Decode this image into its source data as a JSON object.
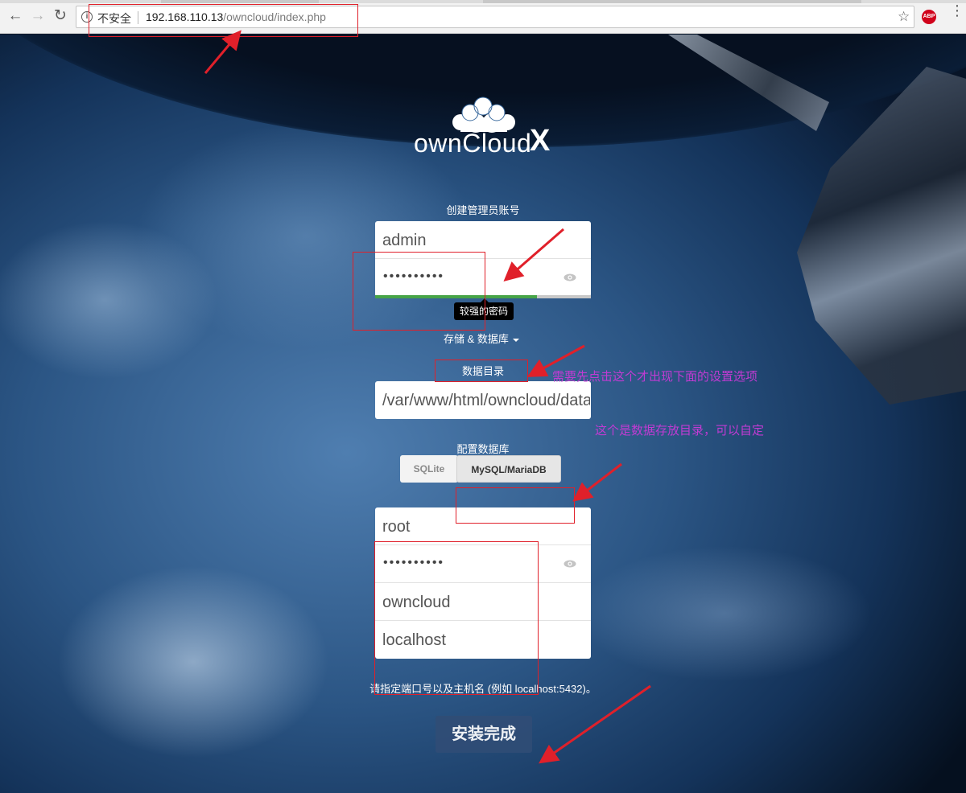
{
  "browser": {
    "security_label": "不安全",
    "url_host": "192.168.110.13",
    "url_path": "/owncloud/index.php",
    "extension_label": "ABP"
  },
  "logo": {
    "text": "ownCloud",
    "mark": "X"
  },
  "admin": {
    "section_label": "创建管理员账号",
    "username": "admin",
    "password_mask": "••••••••••",
    "strength_tooltip": "较强的密码",
    "strength_level": 0.75
  },
  "storage": {
    "toggle_label": "存储 & 数据库"
  },
  "data_dir": {
    "label": "数据目录",
    "value": "/var/www/html/owncloud/data"
  },
  "database": {
    "label": "配置数据库",
    "options": [
      "SQLite",
      "MySQL/MariaDB"
    ],
    "selected": "MySQL/MariaDB",
    "db_user": "root",
    "db_password_mask": "••••••••••",
    "db_name": "owncloud",
    "db_host": "localhost"
  },
  "hint": "请指定端口号以及主机名 (例如 localhost:5432)。",
  "finish_button": "安装完成",
  "annotations": {
    "storage_note": "需要先点击这个才出现下面的设置选项",
    "datadir_note": "这个是数据存放目录，可以自定"
  },
  "colors": {
    "annotation_red": "#e0202a",
    "annotation_purple": "#c13bd3",
    "button_blue": "#304d76"
  }
}
